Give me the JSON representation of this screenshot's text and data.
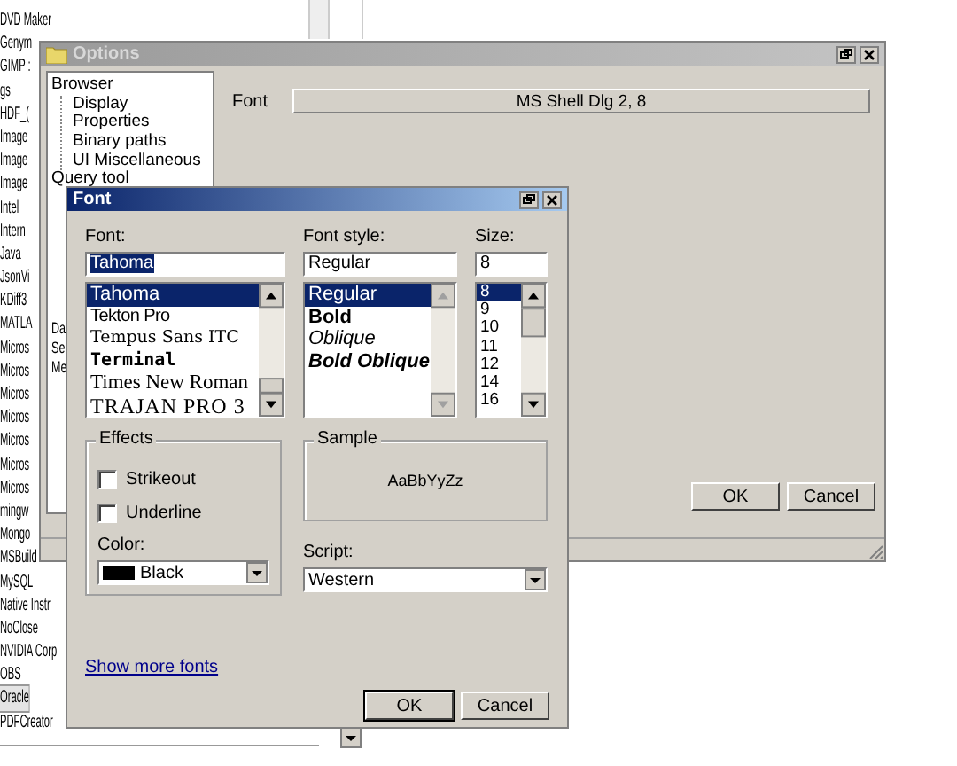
{
  "background_list": {
    "items": [
      {
        "label": "DVD Maker",
        "selected": false
      },
      {
        "label": "Genym",
        "selected": false
      },
      {
        "label": "GIMP :",
        "selected": false
      },
      {
        "label": "gs",
        "selected": false
      },
      {
        "label": "HDF_(",
        "selected": false
      },
      {
        "label": "Image",
        "selected": false
      },
      {
        "label": "Image",
        "selected": false
      },
      {
        "label": "Image",
        "selected": false
      },
      {
        "label": "Intel",
        "selected": false
      },
      {
        "label": "Intern",
        "selected": false
      },
      {
        "label": "Java",
        "selected": false
      },
      {
        "label": "JsonVi",
        "selected": false
      },
      {
        "label": "KDiff3",
        "selected": false
      },
      {
        "label": "MATLA",
        "selected": false
      },
      {
        "label": "Micros",
        "selected": false
      },
      {
        "label": "Micros",
        "selected": false
      },
      {
        "label": "Micros",
        "selected": false
      },
      {
        "label": "Micros",
        "selected": false
      },
      {
        "label": "Micros",
        "selected": false
      },
      {
        "label": "Micros",
        "selected": false
      },
      {
        "label": "Micros",
        "selected": false
      },
      {
        "label": "mingw",
        "selected": false
      },
      {
        "label": "Mongo",
        "selected": false
      },
      {
        "label": "MSBuild",
        "selected": false
      },
      {
        "label": "MySQL",
        "selected": false
      },
      {
        "label": "Native Instr",
        "selected": false
      },
      {
        "label": "NoClose",
        "selected": false
      },
      {
        "label": "NVIDIA Corp",
        "selected": false
      },
      {
        "label": "OBS",
        "selected": false
      },
      {
        "label": "Oracle",
        "selected": true
      },
      {
        "label": "PDFCreator",
        "selected": false
      }
    ]
  },
  "options_window": {
    "title": "Options",
    "tree": [
      {
        "label": "Browser",
        "children": [
          {
            "label": "Display"
          },
          {
            "label": "Properties"
          },
          {
            "label": "Binary paths"
          },
          {
            "label": "UI Miscellaneous"
          }
        ]
      },
      {
        "label": "Query tool"
      },
      {
        "label": "Da"
      },
      {
        "label": "Se"
      },
      {
        "label": "Me"
      }
    ],
    "font_label": "Font",
    "font_value": "MS Shell Dlg 2, 8",
    "buttons": [
      {
        "label": "OK",
        "default": false
      },
      {
        "label": "Cancel",
        "default": false
      }
    ]
  },
  "font_dialog": {
    "title": "Font",
    "font": {
      "label": "Font:",
      "value": "Tahoma",
      "items": [
        {
          "label": "Tahoma",
          "kind": "sans",
          "selected": true
        },
        {
          "label": "Tekton Pro",
          "kind": "narrow",
          "selected": false
        },
        {
          "label": "Tempus Sans ITC",
          "kind": "script",
          "selected": false
        },
        {
          "label": "Terminal",
          "kind": "terminal",
          "selected": false
        },
        {
          "label": "Times New Roman",
          "kind": "serif",
          "selected": false
        },
        {
          "label": "TRAJAN PRO 3",
          "kind": "trajan",
          "selected": false
        }
      ]
    },
    "style": {
      "label": "Font style:",
      "value": "Regular",
      "items": [
        {
          "label": "Regular",
          "kind": "regular",
          "selected": true
        },
        {
          "label": "Bold",
          "kind": "bold",
          "selected": false
        },
        {
          "label": "Oblique",
          "kind": "italic",
          "selected": false
        },
        {
          "label": "Bold Oblique",
          "kind": "bold-italic",
          "selected": false
        }
      ]
    },
    "size": {
      "label": "Size:",
      "value": "8",
      "items": [
        {
          "label": "8",
          "selected": true
        },
        {
          "label": "9",
          "selected": false
        },
        {
          "label": "10",
          "selected": false
        },
        {
          "label": "11",
          "selected": false
        },
        {
          "label": "12",
          "selected": false
        },
        {
          "label": "14",
          "selected": false
        },
        {
          "label": "16",
          "selected": false
        }
      ]
    },
    "effects": {
      "title": "Effects",
      "checkboxes": [
        {
          "label": "Strikeout",
          "checked": false
        },
        {
          "label": "Underline",
          "checked": false
        }
      ],
      "color_label": "Color:",
      "color_value": "Black",
      "color": "#000000"
    },
    "sample": {
      "title": "Sample",
      "text": "AaBbYyZz"
    },
    "script": {
      "label": "Script:",
      "value": "Western"
    },
    "link": "Show more fonts",
    "buttons": [
      {
        "label": "OK",
        "default": true
      },
      {
        "label": "Cancel",
        "default": false
      }
    ]
  }
}
